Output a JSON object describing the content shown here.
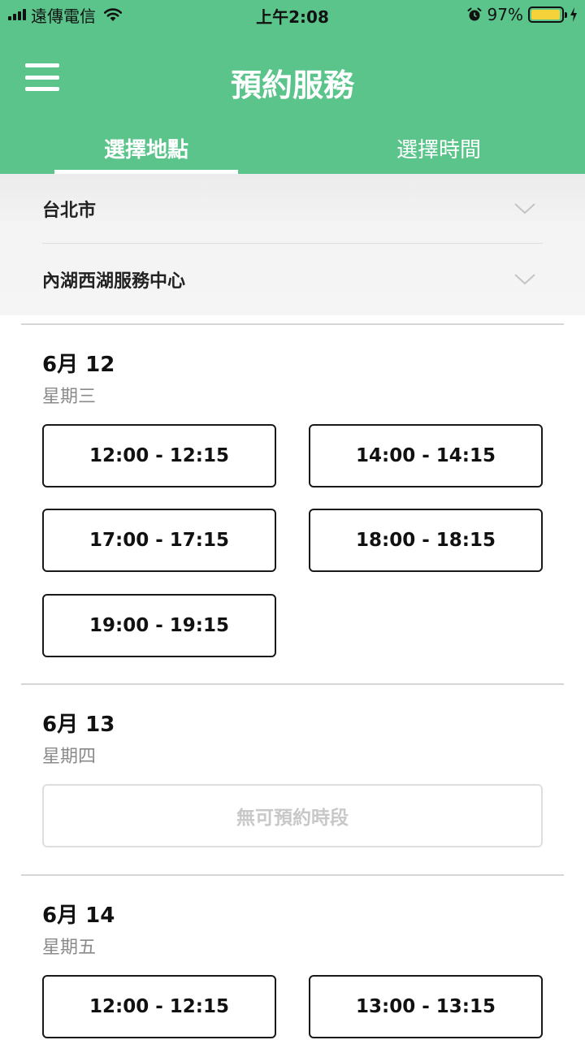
{
  "status_bar": {
    "carrier": "遠傳電信",
    "time": "上午2:08",
    "battery_percent": "97%",
    "battery_level": 0.97,
    "battery_color": "#f5d23a"
  },
  "header": {
    "title": "預約服務",
    "background_color": "#5ac48b",
    "tabs": [
      {
        "label": "選擇地點",
        "active": true
      },
      {
        "label": "選擇時間",
        "active": false
      }
    ]
  },
  "filters": {
    "city": "台北市",
    "service_center": "內湖西湖服務中心"
  },
  "days": [
    {
      "date": "6月 12",
      "weekday": "星期三",
      "slots": [
        "12:00 - 12:15",
        "14:00 - 14:15",
        "17:00 - 17:15",
        "18:00 - 18:15",
        "19:00 - 19:15"
      ]
    },
    {
      "date": "6月 13",
      "weekday": "星期四",
      "unavailable_label": "無可預約時段"
    },
    {
      "date": "6月 14",
      "weekday": "星期五",
      "slots": [
        "12:00 - 12:15",
        "13:00 - 13:15"
      ]
    }
  ]
}
